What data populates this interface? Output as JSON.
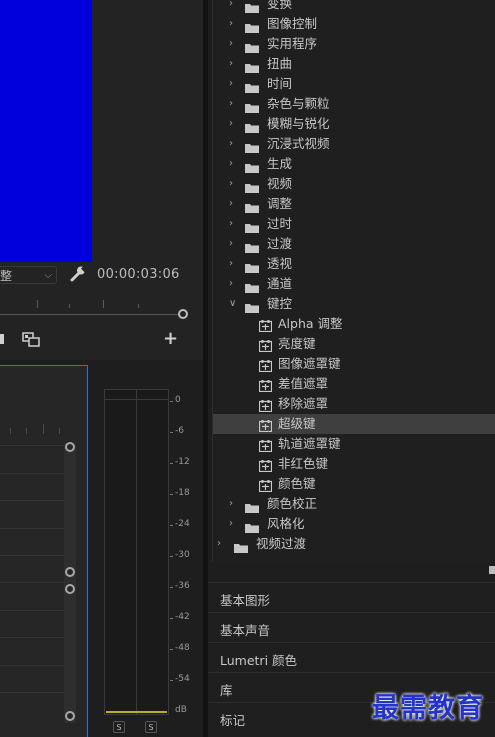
{
  "program_monitor": {
    "zoom_value": "整",
    "timecode": "00:00:03:06",
    "add_label": "+"
  },
  "audio_meter": {
    "db_ticks": [
      "0",
      "-6",
      "-12",
      "-18",
      "-24",
      "-30",
      "-36",
      "-42",
      "-48",
      "-54",
      "dB"
    ],
    "solo_left": "S",
    "solo_right": "S"
  },
  "effects_tree": {
    "items": [
      {
        "label": "变换",
        "type": "folder",
        "expanded": false
      },
      {
        "label": "图像控制",
        "type": "folder",
        "expanded": false
      },
      {
        "label": "实用程序",
        "type": "folder",
        "expanded": false
      },
      {
        "label": "扭曲",
        "type": "folder",
        "expanded": false
      },
      {
        "label": "时间",
        "type": "folder",
        "expanded": false
      },
      {
        "label": "杂色与颗粒",
        "type": "folder",
        "expanded": false
      },
      {
        "label": "模糊与锐化",
        "type": "folder",
        "expanded": false
      },
      {
        "label": "沉浸式视频",
        "type": "folder",
        "expanded": false
      },
      {
        "label": "生成",
        "type": "folder",
        "expanded": false
      },
      {
        "label": "视频",
        "type": "folder",
        "expanded": false
      },
      {
        "label": "调整",
        "type": "folder",
        "expanded": false
      },
      {
        "label": "过时",
        "type": "folder",
        "expanded": false
      },
      {
        "label": "过渡",
        "type": "folder",
        "expanded": false
      },
      {
        "label": "透视",
        "type": "folder",
        "expanded": false
      },
      {
        "label": "通道",
        "type": "folder",
        "expanded": false
      },
      {
        "label": "键控",
        "type": "folder",
        "expanded": true
      },
      {
        "label": "Alpha 调整",
        "type": "effect"
      },
      {
        "label": "亮度键",
        "type": "effect"
      },
      {
        "label": "图像遮罩键",
        "type": "effect"
      },
      {
        "label": "差值遮罩",
        "type": "effect"
      },
      {
        "label": "移除遮罩",
        "type": "effect"
      },
      {
        "label": "超级键",
        "type": "effect",
        "selected": true
      },
      {
        "label": "轨道遮罩键",
        "type": "effect"
      },
      {
        "label": "非红色键",
        "type": "effect"
      },
      {
        "label": "颜色键",
        "type": "effect"
      },
      {
        "label": "颜色校正",
        "type": "folder",
        "expanded": false
      },
      {
        "label": "风格化",
        "type": "folder",
        "expanded": false
      },
      {
        "label": "视频过渡",
        "type": "folder",
        "expanded": false,
        "top_level": true
      }
    ]
  },
  "panels": [
    "基本图形",
    "基本声音",
    "Lumetri 颜色",
    "库",
    "标记"
  ],
  "watermark": "最需教育",
  "colors": {
    "video_fill": "#0000dc",
    "selection": "#3f3f3f",
    "timeline_border": "#2c75c9",
    "watermark": "#2434c8"
  }
}
